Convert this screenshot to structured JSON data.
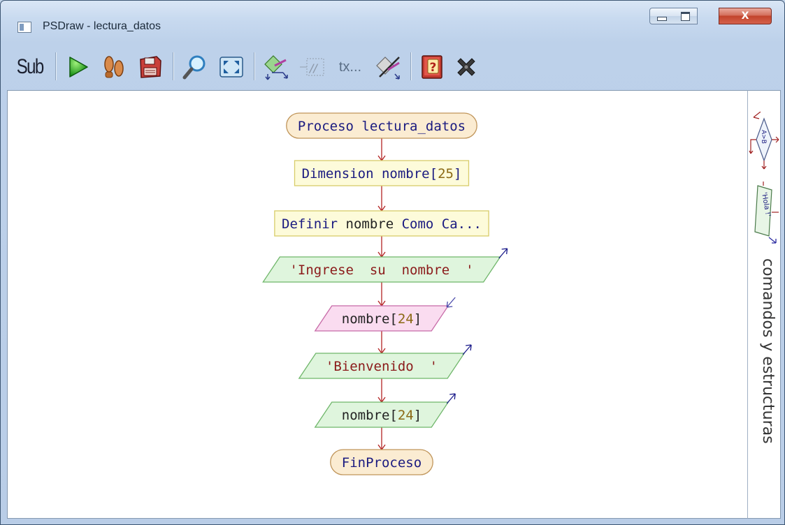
{
  "window": {
    "title": "PSDraw - lectura_datos",
    "controls": {
      "close_glyph": "X"
    }
  },
  "toolbar": {
    "sub_label": "Sub",
    "tx_label": "tx...",
    "buttons": [
      {
        "name": "sub-button",
        "icon": "sub-icon"
      },
      {
        "name": "run-button",
        "icon": "play-icon"
      },
      {
        "name": "step-button",
        "icon": "footprints-icon"
      },
      {
        "name": "save-button",
        "icon": "floppy-icon"
      },
      {
        "name": "zoom-button",
        "icon": "magnifier-icon"
      },
      {
        "name": "fit-button",
        "icon": "fit-screen-icon"
      },
      {
        "name": "edit-node-button",
        "icon": "edit-shape-icon"
      },
      {
        "name": "comment-button",
        "icon": "comment-icon"
      },
      {
        "name": "text-button",
        "icon": "text-icon"
      },
      {
        "name": "delete-node-button",
        "icon": "cut-shape-icon"
      },
      {
        "name": "help-button",
        "icon": "help-book-icon"
      },
      {
        "name": "close-diagram-button",
        "icon": "close-x-icon"
      }
    ]
  },
  "flowchart": {
    "nodes": [
      {
        "kind": "terminal",
        "parts": [
          [
            "kw",
            "Proceso lectura_datos"
          ]
        ]
      },
      {
        "kind": "process",
        "parts": [
          [
            "kw",
            "Dimension nombre["
          ],
          [
            "num",
            "25"
          ],
          [
            "kw",
            "]"
          ]
        ]
      },
      {
        "kind": "process",
        "parts": [
          [
            "kw",
            "Definir"
          ],
          [
            "plain",
            " nombre "
          ],
          [
            "kw",
            "Como Ca..."
          ]
        ]
      },
      {
        "kind": "output",
        "parts": [
          [
            "str",
            "'Ingrese  su  nombre  '"
          ]
        ]
      },
      {
        "kind": "input",
        "parts": [
          [
            "plain",
            "nombre["
          ],
          [
            "num",
            "24"
          ],
          [
            "plain",
            "]"
          ]
        ]
      },
      {
        "kind": "output",
        "parts": [
          [
            "str",
            "'Bienvenido  '"
          ]
        ]
      },
      {
        "kind": "output",
        "parts": [
          [
            "plain",
            "nombre["
          ],
          [
            "num",
            "24"
          ],
          [
            "plain",
            "]"
          ]
        ]
      },
      {
        "kind": "terminal",
        "parts": [
          [
            "kw",
            "FinProceso"
          ]
        ]
      }
    ]
  },
  "side_panel": {
    "label": "comandos y estructuras",
    "tools": [
      {
        "name": "decision-tool",
        "label": "A>B"
      },
      {
        "name": "output-tool",
        "label": "'Hola !'"
      }
    ]
  },
  "colors": {
    "keyword": "#1a1a80",
    "string": "#8b1a1a",
    "number": "#8b6914",
    "plain": "#222222",
    "connector": "#b22222",
    "terminal_fill": "#fbecd2",
    "terminal_stroke": "#c0955a",
    "process_fill": "#fdfbda",
    "process_stroke": "#d8cc6a",
    "output_fill": "#dff5dd",
    "output_stroke": "#6fb66a",
    "input_fill": "#fadcf0",
    "input_stroke": "#c76aa7",
    "arrow_out": "#1a1a8a",
    "arrow_in": "#4a4aaa"
  }
}
